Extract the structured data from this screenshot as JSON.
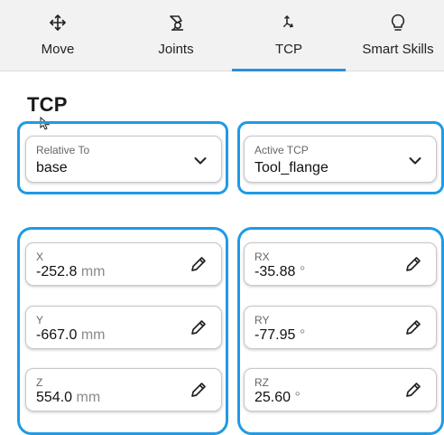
{
  "tabs": [
    {
      "label": "Move",
      "icon": "move-arrows-icon",
      "active": false
    },
    {
      "label": "Joints",
      "icon": "robot-joint-icon",
      "active": false
    },
    {
      "label": "TCP",
      "icon": "tcp-axes-icon",
      "active": true
    },
    {
      "label": "Smart Skills",
      "icon": "lightbulb-icon",
      "active": false
    }
  ],
  "page_title": "TCP",
  "relative_to": {
    "label": "Relative To",
    "value": "base"
  },
  "active_tcp": {
    "label": "Active TCP",
    "value": "Tool_flange"
  },
  "position": {
    "x": {
      "label": "X",
      "value": "-252.8",
      "unit": "mm"
    },
    "y": {
      "label": "Y",
      "value": "-667.0",
      "unit": "mm"
    },
    "z": {
      "label": "Z",
      "value": "554.0",
      "unit": "mm"
    }
  },
  "rotation": {
    "rx": {
      "label": "RX",
      "value": "-35.88",
      "unit": "°"
    },
    "ry": {
      "label": "RY",
      "value": "-77.95",
      "unit": "°"
    },
    "rz": {
      "label": "RZ",
      "value": "25.60",
      "unit": "°"
    }
  },
  "colors": {
    "accent": "#1e9be6",
    "active_tab_underline": "#2f8fd8",
    "tab_bar_bg": "#f2f2f2"
  }
}
